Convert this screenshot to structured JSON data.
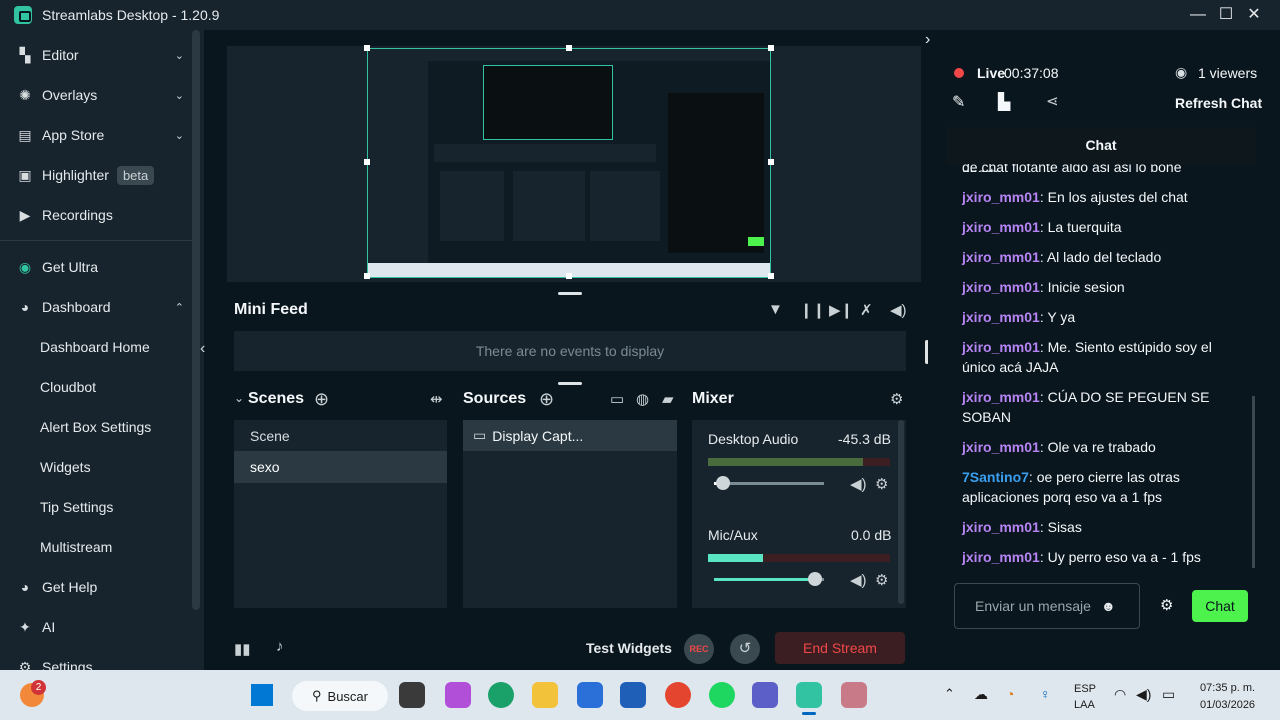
{
  "window": {
    "title": "Streamlabs Desktop - 1.20.9",
    "minimize": "—",
    "maximize": "☐",
    "close": "✕"
  },
  "sidebar": {
    "items": [
      {
        "label": "Editor",
        "icon": "editor-icon"
      },
      {
        "label": "Overlays",
        "icon": "overlays-icon"
      },
      {
        "label": "App Store",
        "icon": "app-store-icon"
      },
      {
        "label": "Highlighter",
        "badge": "beta",
        "icon": "highlighter-icon"
      },
      {
        "label": "Recordings",
        "icon": "recordings-icon"
      },
      {
        "label": "Get Ultra",
        "icon": "ultra-icon"
      },
      {
        "label": "Dashboard",
        "icon": "dashboard-icon"
      },
      {
        "label": "Dashboard Home"
      },
      {
        "label": "Cloudbot"
      },
      {
        "label": "Alert Box Settings"
      },
      {
        "label": "Widgets"
      },
      {
        "label": "Tip Settings"
      },
      {
        "label": "Multistream"
      },
      {
        "label": "Get Help",
        "icon": "help-icon"
      },
      {
        "label": "AI",
        "icon": "ai-icon"
      },
      {
        "label": "Settings",
        "icon": "settings-icon"
      }
    ]
  },
  "minifeed": {
    "title": "Mini Feed",
    "empty": "There are no events to display"
  },
  "scenes": {
    "title": "Scenes",
    "items": [
      "Scene",
      "sexo"
    ],
    "selected": "sexo"
  },
  "sources": {
    "title": "Sources",
    "items": [
      "Display Capt..."
    ]
  },
  "mixer": {
    "title": "Mixer",
    "channels": [
      {
        "name": "Desktop Audio",
        "db": "-45.3 dB",
        "level": 0.85,
        "volume": 0.08
      },
      {
        "name": "Mic/Aux",
        "db": "0.0 dB",
        "level": 0.3,
        "volume": 0.92
      }
    ]
  },
  "footer": {
    "test_widgets": "Test Widgets",
    "rec": "REC",
    "end_stream": "End Stream"
  },
  "live": {
    "label": "Live",
    "time": "00:37:08",
    "viewers": "1 viewers",
    "refresh": "Refresh Chat"
  },
  "chat": {
    "header": "Chat",
    "messages": [
      {
        "user": "",
        "text": "de chat flotante algo asi asi lo pone aparte"
      },
      {
        "user": "jxiro_mm01",
        "text": "En los ajustes del chat"
      },
      {
        "user": "jxiro_mm01",
        "text": "La tuerquita"
      },
      {
        "user": "jxiro_mm01",
        "text": "Al lado del teclado"
      },
      {
        "user": "jxiro_mm01",
        "text": "Inicie sesion"
      },
      {
        "user": "jxiro_mm01",
        "text": "Y ya"
      },
      {
        "user": "jxiro_mm01",
        "text": "Me. Siento estúpido soy el único acá JAJA"
      },
      {
        "user": "jxiro_mm01",
        "text": "CÚA DO SE PEGUEN SE SOBAN"
      },
      {
        "user": "jxiro_mm01",
        "text": "Ole va re trabado"
      },
      {
        "user": "7Santino7",
        "text": "oe pero cierre las otras aplicaciones porq eso va a 1 fps"
      },
      {
        "user": "jxiro_mm01",
        "text": "Sisas"
      },
      {
        "user": "jxiro_mm01",
        "text": "Uy perro eso va a - 1 fps"
      }
    ],
    "input_placeholder": "Enviar un mensaje",
    "send": "Chat"
  },
  "taskbar": {
    "search": "Buscar",
    "lang": "ESP",
    "lang2": "LAA",
    "time": "07:35 p. m.",
    "date": "01/03/2026",
    "badge": "2"
  },
  "colors": {
    "accent": "#31c3a2",
    "live": "#f04848",
    "send": "#4df24d",
    "username": "#b784f5",
    "username2": "#3a9ff0"
  }
}
